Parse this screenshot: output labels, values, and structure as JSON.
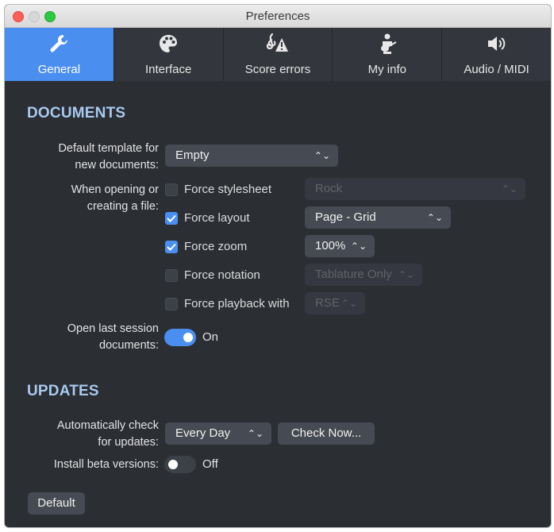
{
  "window": {
    "title": "Preferences"
  },
  "tabs": [
    {
      "label": "General",
      "icon": "wrench-icon",
      "active": true
    },
    {
      "label": "Interface",
      "icon": "palette-icon"
    },
    {
      "label": "Score errors",
      "icon": "clef-warning-icon"
    },
    {
      "label": "My info",
      "icon": "guitarist-icon"
    },
    {
      "label": "Audio / MIDI",
      "icon": "speaker-icon"
    }
  ],
  "documents": {
    "heading": "DOCUMENTS",
    "template_label_1": "Default template for",
    "template_label_2": "new documents:",
    "template_value": "Empty",
    "opening_label_1": "When opening or",
    "opening_label_2": "creating a file:",
    "options": [
      {
        "label": "Force stylesheet",
        "checked": false,
        "value": "Rock",
        "enabled": false
      },
      {
        "label": "Force layout",
        "checked": true,
        "value": "Page - Grid",
        "enabled": true
      },
      {
        "label": "Force zoom",
        "checked": true,
        "value": "100%",
        "enabled": true
      },
      {
        "label": "Force notation",
        "checked": false,
        "value": "Tablature Only",
        "enabled": false
      },
      {
        "label": "Force playback with",
        "checked": false,
        "value": "RSE",
        "enabled": false
      }
    ],
    "session_label_1": "Open last session",
    "session_label_2": "documents:",
    "session_state": "On"
  },
  "updates": {
    "heading": "UPDATES",
    "auto_label_1": "Automatically check",
    "auto_label_2": "for updates:",
    "frequency": "Every Day",
    "check_now": "Check Now...",
    "beta_label": "Install beta versions:",
    "beta_state": "Off"
  },
  "footer": {
    "default_button": "Default"
  },
  "colors": {
    "accent": "#4a8ef0",
    "background": "#2b2e33",
    "heading": "#a9c9ef"
  }
}
